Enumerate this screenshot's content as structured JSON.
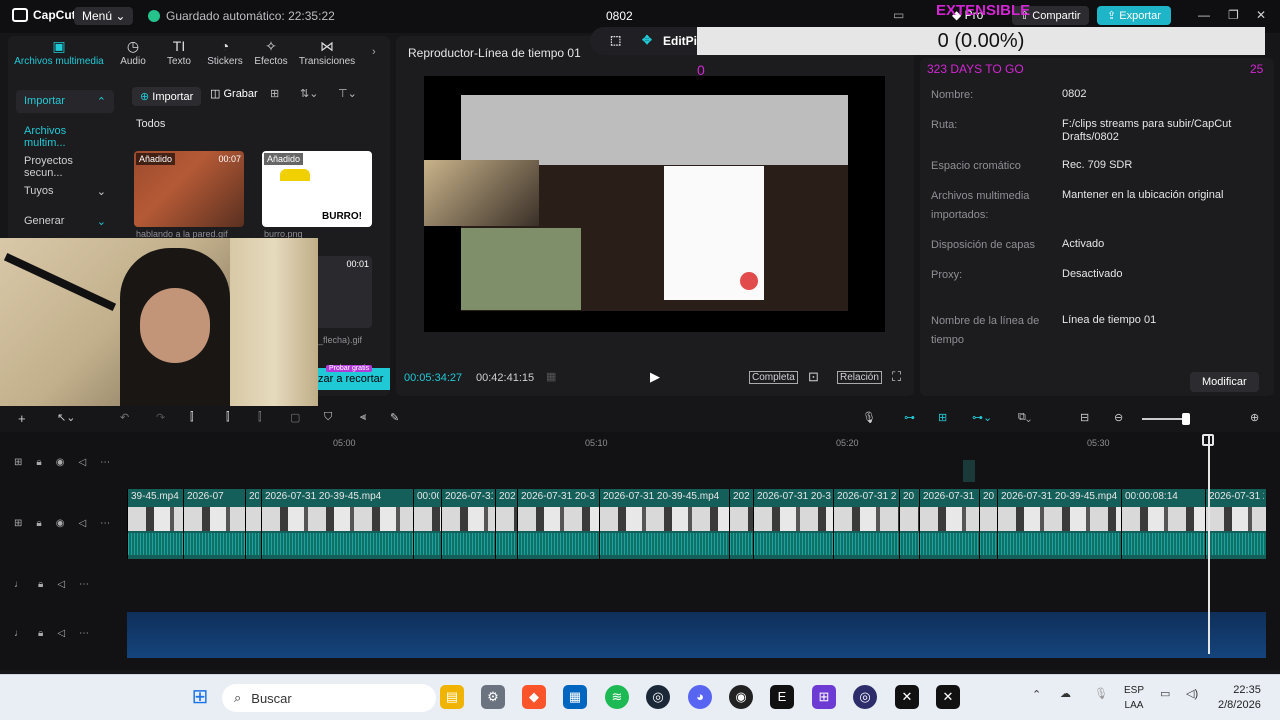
{
  "app": {
    "name": "CapCut",
    "menu": "Menú",
    "autosave": "Guardado automático: 22:35:22",
    "project": "0802",
    "pro": "Pro",
    "share": "Compartir",
    "export": "Exportar"
  },
  "overlay": {
    "top_label": "EXTENSIBLE",
    "progress": "0 (0.00%)",
    "days": "323 DAYS TO GO",
    "left_num": "0",
    "right_num": "25",
    "editpi": "EditPi"
  },
  "toolbar": {
    "tabs": [
      {
        "label": "Archivos multimedia",
        "icon": "play-square-icon"
      },
      {
        "label": "Audio",
        "icon": "audio-icon"
      },
      {
        "label": "Texto",
        "icon": "text-icon"
      },
      {
        "label": "Stickers",
        "icon": "sticker-icon"
      },
      {
        "label": "Efectos",
        "icon": "effects-icon"
      },
      {
        "label": "Transiciones",
        "icon": "transitions-icon"
      }
    ]
  },
  "media": {
    "sidebar": [
      {
        "label": "Importar"
      },
      {
        "label": "Archivos multim..."
      },
      {
        "label": "Proyectos secun..."
      },
      {
        "label": "Tuyos"
      },
      {
        "label": "Generar"
      }
    ],
    "import_btn": "Importar",
    "record_btn": "Grabar",
    "filter": "Todos",
    "thumbs": [
      {
        "badge": "Añadido",
        "duration": "00:07",
        "label": "hablando a la pared.gif"
      },
      {
        "badge": "Añadido",
        "duration": "",
        "label": "burro.png",
        "caption": "BURRO!"
      },
      {
        "badge": "",
        "duration": "00:01",
        "label": "_flecha).gif"
      }
    ],
    "promo": "zar a recortar",
    "promo_tag": "Probar gratis"
  },
  "player": {
    "title": "Reproductor-Línea de tiempo 01",
    "current": "00:05:34:27",
    "total": "00:42:41:15",
    "full": "Completa",
    "ratio": "Relación"
  },
  "details": {
    "rows": [
      {
        "k": "Nombre:",
        "v": "0802"
      },
      {
        "k": "Ruta:",
        "v": "F:/clips streams para subir/CapCut Drafts/0802"
      },
      {
        "k": "Espacio cromático",
        "v": "Rec. 709 SDR"
      },
      {
        "k": "Archivos multimedia importados:",
        "v": "Mantener en la ubicación original"
      },
      {
        "k": "Disposición de capas",
        "v": "Activado"
      },
      {
        "k": "Proxy:",
        "v": "Desactivado"
      },
      {
        "k": "Nombre de la línea de tiempo",
        "v": "Línea de tiempo 01"
      }
    ],
    "modify": "Modificar"
  },
  "timeline": {
    "ruler": [
      "05:00",
      "05:10",
      "05:20",
      "05:30"
    ],
    "clips": [
      {
        "name": "39-45.mp4"
      },
      {
        "name": "2026-07"
      },
      {
        "name": "20"
      },
      {
        "name": "2026-07-31 20-39-45.mp4"
      },
      {
        "name": "00:00"
      },
      {
        "name": "2026-07-31"
      },
      {
        "name": "202"
      },
      {
        "name": "2026-07-31 20-3"
      },
      {
        "name": "2026-07-31 20-39-45.mp4"
      },
      {
        "name": "202"
      },
      {
        "name": "2026-07-31 20-3"
      },
      {
        "name": "2026-07-31 2"
      },
      {
        "name": "20"
      },
      {
        "name": "2026-07-31"
      },
      {
        "name": "20"
      },
      {
        "name": "2026-07-31 20-39-45.mp4"
      },
      {
        "name": "00:00:08:14"
      },
      {
        "name": "2026-07-31 20-3"
      }
    ]
  },
  "taskbar": {
    "search": "Buscar",
    "lang1": "ESP",
    "lang2": "LAA",
    "time": "22:35",
    "date": "2/8/2026"
  }
}
